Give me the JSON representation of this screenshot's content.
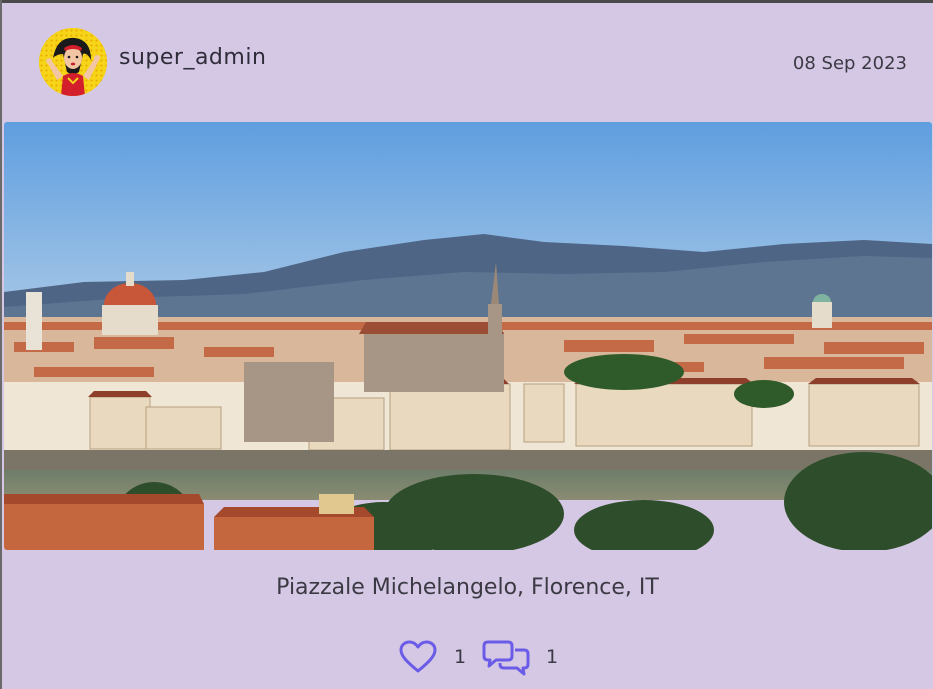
{
  "post": {
    "author": {
      "username": "super_admin",
      "avatar_icon": "superhero-avatar"
    },
    "date": "08 Sep 2023",
    "image": {
      "subject": "panorama-city-river-mountains"
    },
    "caption": "Piazzale Michelangelo, Florence, IT",
    "likes": {
      "count": "1",
      "icon": "heart-icon",
      "color": "#6b5ce7"
    },
    "comments": {
      "count": "1",
      "icon": "comments-icon",
      "color": "#6b5ce7"
    }
  },
  "colors": {
    "background": "#d5c8e5",
    "text": "#3b3a44",
    "accent": "#6b5ce7"
  }
}
